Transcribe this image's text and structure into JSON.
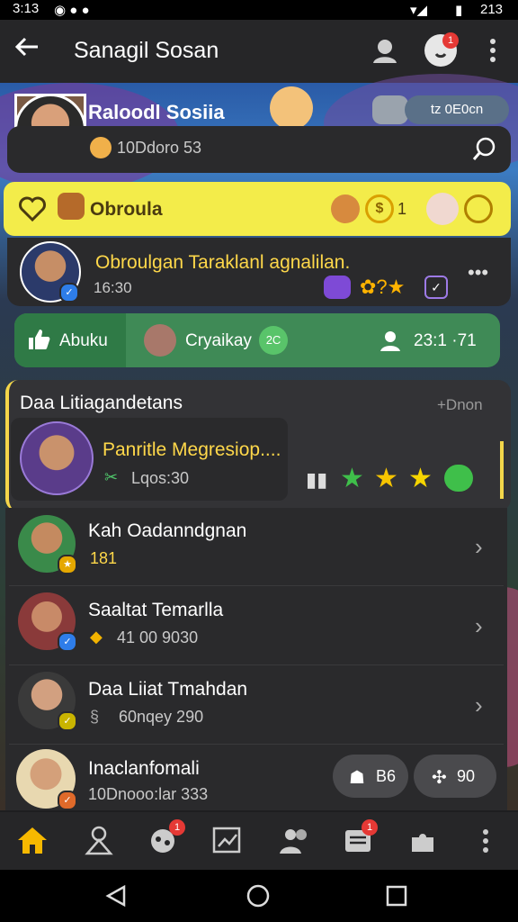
{
  "status_bar": {
    "time": "3:13",
    "battery": "213"
  },
  "app_bar": {
    "title": "Sanagil Sosan",
    "notif_count": "1"
  },
  "profile": {
    "name": "Raloodl Sosiia",
    "count_text": "10Ddoro 53",
    "chip_text": "tz  0E0cn"
  },
  "banner": {
    "label": "Obroula",
    "coin_count": "1"
  },
  "feed_post": {
    "message": "Obroulgan Taraklanl agnalilan.",
    "time": "16:30"
  },
  "actions": {
    "like_label": "Abuku",
    "user_label": "Cryaikay",
    "user_chip": "2C",
    "stat": "23:1 ·71"
  },
  "leaderboard": {
    "title": "Daa Litiagandetans",
    "more": "+Dnon"
  },
  "highlight": {
    "title": "Panritle Megresiop....",
    "sub": "Lqos:30"
  },
  "list": [
    {
      "name": "Kah Oadanndgnan",
      "sub": "181"
    },
    {
      "name": "Saaltat Temarlla",
      "sub": "41 00 9030"
    },
    {
      "name": "Daa Liiat Tmahdan",
      "sub": "60nqey 290"
    },
    {
      "name": "Inaclanfomali",
      "sub": "10Dnooo:lar 333"
    }
  ],
  "pills": {
    "a": "B6",
    "b": "90"
  },
  "bottom_nav": {
    "badge1": "1",
    "badge2": "1"
  }
}
